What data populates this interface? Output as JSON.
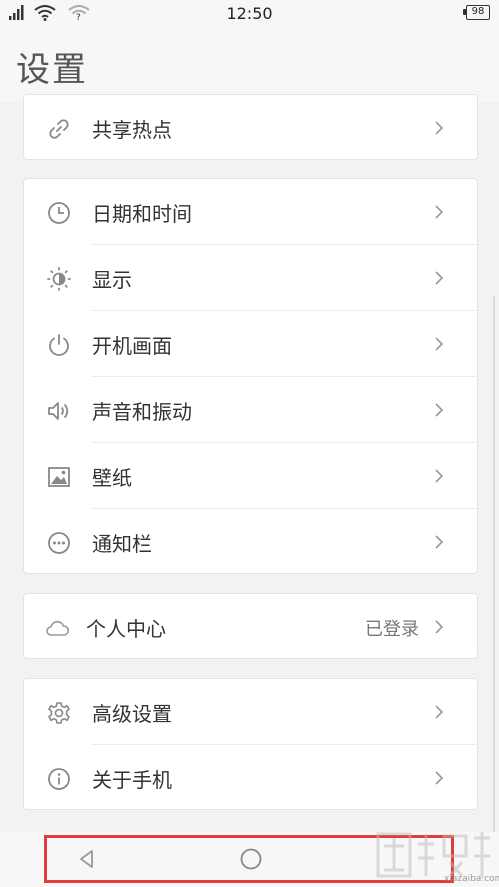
{
  "status_bar": {
    "time": "12:50",
    "battery": "98",
    "icons": [
      "signal-icon",
      "wifi-icon",
      "hotspot-icon"
    ]
  },
  "header": {
    "title": "设置"
  },
  "groups": [
    {
      "items": [
        {
          "icon": "link-icon",
          "label": "共享热点",
          "value": ""
        }
      ]
    },
    {
      "items": [
        {
          "icon": "clock-icon",
          "label": "日期和时间",
          "value": ""
        },
        {
          "icon": "brightness-icon",
          "label": "显示",
          "value": ""
        },
        {
          "icon": "power-icon",
          "label": "开机画面",
          "value": ""
        },
        {
          "icon": "speaker-icon",
          "label": "声音和振动",
          "value": ""
        },
        {
          "icon": "wallpaper-icon",
          "label": "壁纸",
          "value": ""
        },
        {
          "icon": "more-icon",
          "label": "通知栏",
          "value": ""
        }
      ]
    },
    {
      "items": [
        {
          "icon": "cloud-icon",
          "label": "个人中心",
          "value": "已登录"
        }
      ]
    },
    {
      "items": [
        {
          "icon": "gear-icon",
          "label": "高级设置",
          "value": ""
        },
        {
          "icon": "info-icon",
          "label": "关于手机",
          "value": ""
        }
      ]
    }
  ],
  "nav_bar": {
    "buttons": [
      "back-button",
      "home-button"
    ],
    "highlight_color": "#e23b3b"
  },
  "watermark": {
    "text": "xiazaiba.com"
  }
}
